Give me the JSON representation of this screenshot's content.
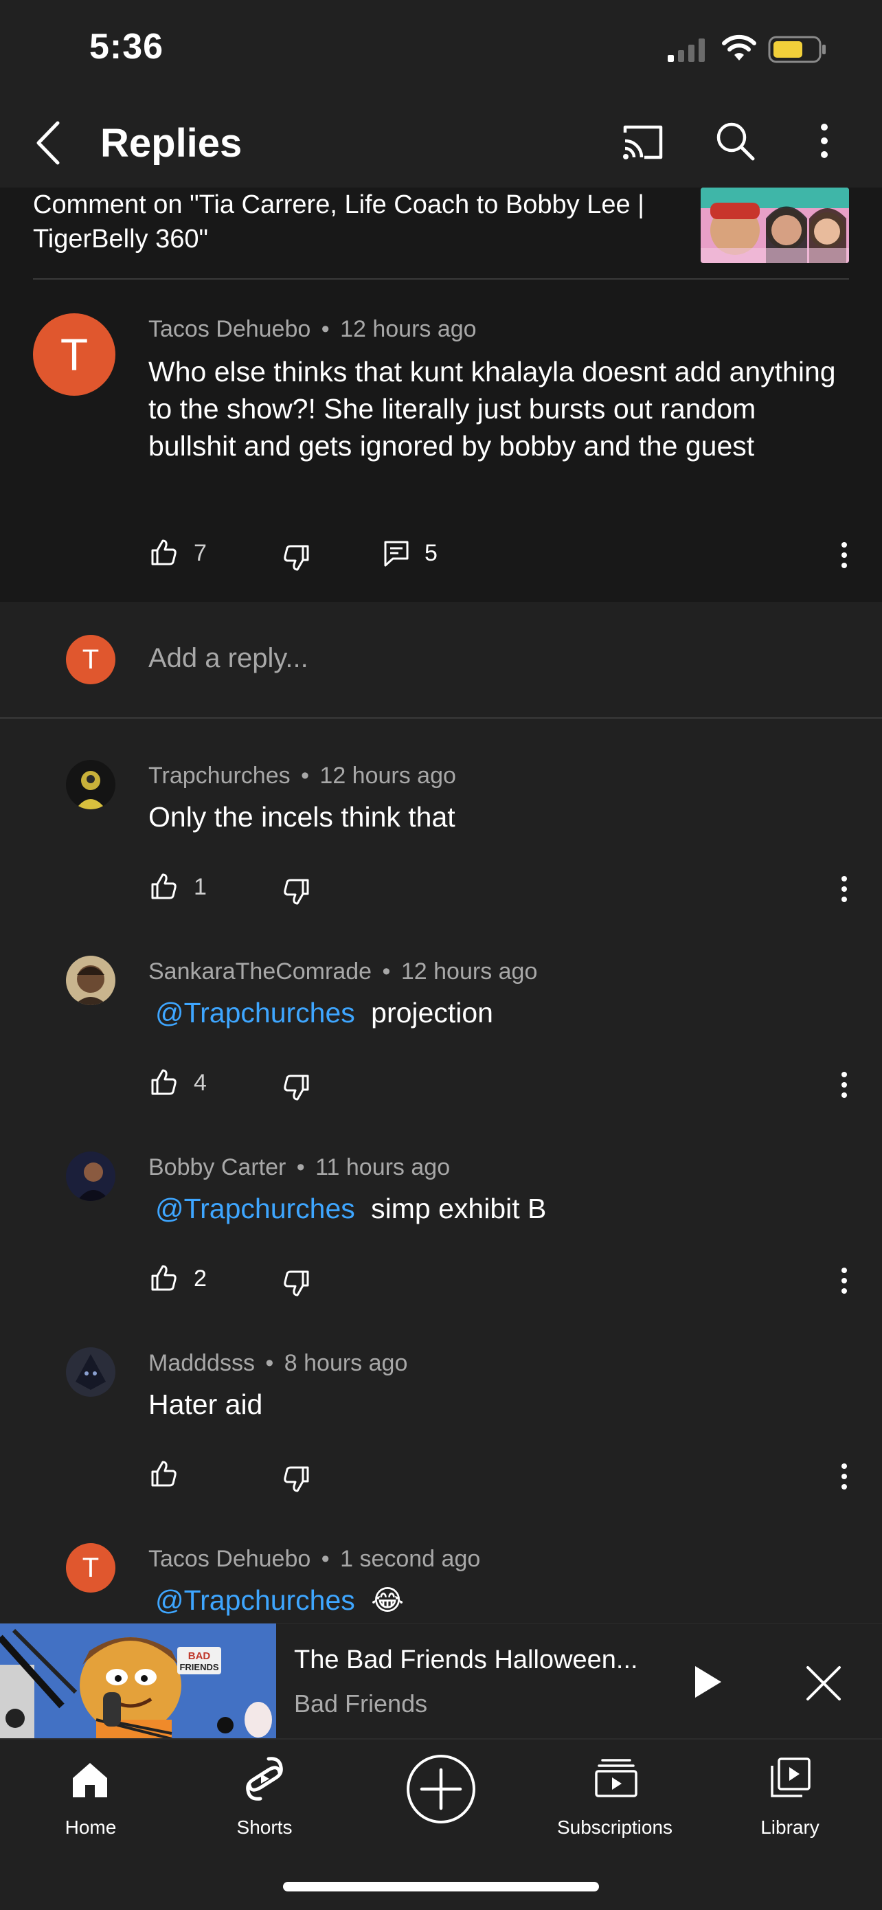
{
  "status_bar": {
    "time": "5:36"
  },
  "header": {
    "title": "Replies"
  },
  "video": {
    "comment_on": "Comment on \"Tia Carrere, Life Coach to Bobby Lee | TigerBelly 360\""
  },
  "parent_comment": {
    "avatar_letter": "T",
    "author": "Tacos Dehuebo",
    "time": "12 hours ago",
    "text": "Who else thinks that kunt khalayla doesnt add anything to the show?! She literally just bursts out random bullshit and gets ignored by bobby and the guest",
    "likes": "7",
    "replies": "5"
  },
  "reply_input": {
    "avatar_letter": "T",
    "placeholder": "Add a reply..."
  },
  "separator": "•",
  "replies": [
    {
      "author": "Trapchurches",
      "time": "12 hours ago",
      "mention": "",
      "text": "Only the incels think that",
      "likes": "1"
    },
    {
      "author": "SankaraTheComrade",
      "time": "12 hours ago",
      "mention": "@Trapchurches",
      "text": "projection",
      "likes": "4"
    },
    {
      "author": "Bobby Carter",
      "time": "11 hours ago",
      "mention": "@Trapchurches",
      "text": "simp exhibit B",
      "likes": "2"
    },
    {
      "author": "Madddsss",
      "time": "8 hours ago",
      "mention": "",
      "text": "Hater aid",
      "likes": ""
    },
    {
      "author": "Tacos Dehuebo",
      "avatar_letter": "T",
      "time": "1 second ago",
      "mention": "@Trapchurches",
      "text": "😂",
      "likes": ""
    }
  ],
  "mini_player": {
    "title": "The Bad Friends Halloween...",
    "channel": "Bad Friends",
    "thumbnail_text": "BAD FRIENDS"
  },
  "nav": {
    "home": "Home",
    "shorts": "Shorts",
    "subscriptions": "Subscriptions",
    "library": "Library"
  },
  "colors": {
    "accent_avatar": "#e0572e",
    "mention": "#3ea6ff",
    "background": "#212121",
    "battery": "#f2d03a"
  }
}
